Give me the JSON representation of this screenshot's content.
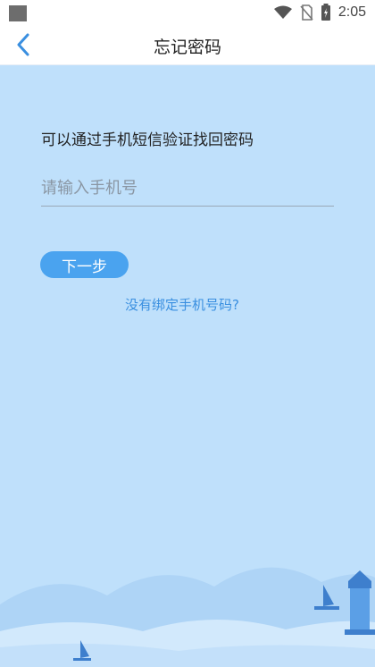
{
  "status_bar": {
    "time": "2:05"
  },
  "app_bar": {
    "title": "忘记密码"
  },
  "form": {
    "instruction": "可以通过手机短信验证找回密码",
    "phone_placeholder": "请输入手机号",
    "next_label": "下一步",
    "unbound_link": "没有绑定手机号码?"
  },
  "colors": {
    "accent": "#4aa3ef",
    "link": "#3a8fe0",
    "background": "#bfe0fb"
  }
}
